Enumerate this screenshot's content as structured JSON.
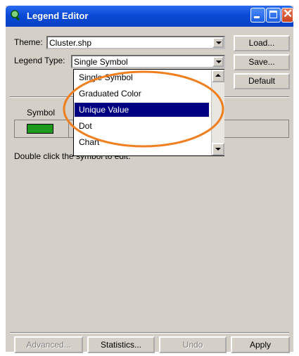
{
  "window": {
    "title": "Legend Editor"
  },
  "theme": {
    "label": "Theme:",
    "value": "Cluster.shp"
  },
  "legend_type": {
    "label": "Legend Type:",
    "value": "Single Symbol",
    "options": [
      "Single Symbol",
      "Graduated Color",
      "Unique Value",
      "Dot",
      "Chart"
    ],
    "selected_option": "Unique Value"
  },
  "buttons": {
    "load": "Load...",
    "save": "Save...",
    "default": "Default",
    "advanced": "Advanced...",
    "statistics": "Statistics...",
    "undo": "Undo",
    "apply": "Apply"
  },
  "symbol_table": {
    "header": "Symbol",
    "hint": "Double click the symbol to edit.",
    "symbol_color": "#1f9a1f"
  },
  "colors": {
    "annotation_circle": "#f07f20",
    "selection": "#000080"
  }
}
